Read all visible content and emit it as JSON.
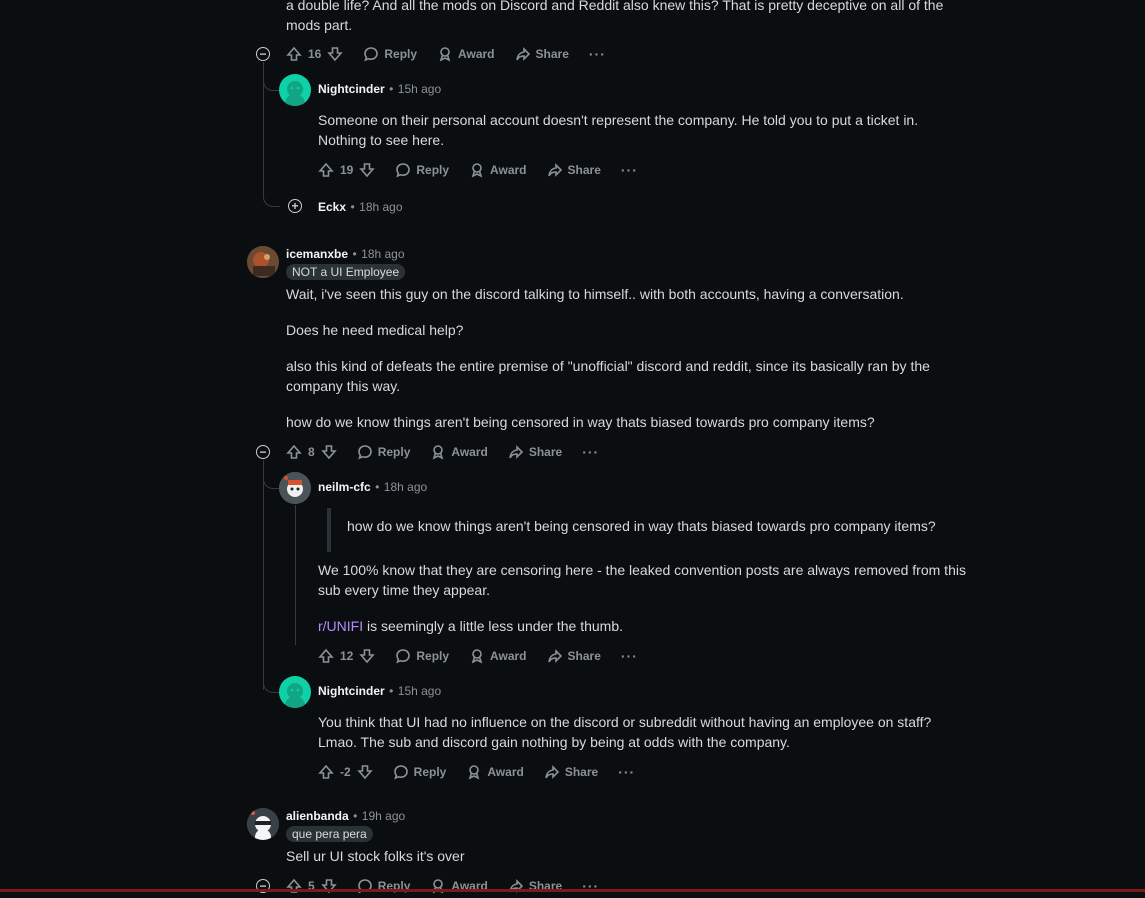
{
  "top_comment": {
    "text_line1": "a double life? And all the mods on Discord and Reddit also knew this? That is pretty deceptive on all of the",
    "text_line2": "mods part.",
    "votes": "16"
  },
  "actions": {
    "reply": "Reply",
    "award": "Award",
    "share": "Share",
    "more": "···"
  },
  "replies_1": [
    {
      "author": "Nightcinder",
      "sep": "•",
      "time": "15h ago",
      "line1": "Someone on their personal account doesn't represent the company. He told you to put a ticket in.",
      "line2": "Nothing to see here.",
      "votes": "19"
    },
    {
      "author": "Eckx",
      "sep": "•",
      "time": "18h ago"
    }
  ],
  "comment_2": {
    "author": "icemanxbe",
    "sep": "•",
    "time": "18h ago",
    "flair": "NOT a UI Employee",
    "p1": "Wait, i've seen this guy on the discord talking to himself.. with both accounts, having a conversation.",
    "p2": "Does he need medical help?",
    "p3_line1": "also this kind of defeats the entire premise of \"unofficial\" discord and reddit, since its basically ran by the",
    "p3_line2": "company this way.",
    "p4": "how do we know things aren't being censored in way thats biased towards pro company items?",
    "votes": "8"
  },
  "replies_2": [
    {
      "author": "neilm-cfc",
      "sep": "•",
      "time": "18h ago",
      "quote": "how do we know things aren't being censored in way thats biased towards pro company items?",
      "line1": "We 100% know that they are censoring here - the leaked convention posts are always removed from this",
      "line2": "sub every time they appear.",
      "link": "r/UNIFI",
      "after_link": " is seemingly a little less under the thumb.",
      "votes": "12"
    },
    {
      "author": "Nightcinder",
      "sep": "•",
      "time": "15h ago",
      "line1": "You think that UI had no influence on the discord or subreddit without having an employee on staff?",
      "line2": "Lmao. The sub and discord gain nothing by being at odds with the company.",
      "votes": "-2"
    }
  ],
  "comment_3": {
    "author": "alienbanda",
    "sep": "•",
    "time": "19h ago",
    "flair": "que pera pera",
    "text": "Sell ur UI stock folks it's over",
    "votes": "5"
  }
}
